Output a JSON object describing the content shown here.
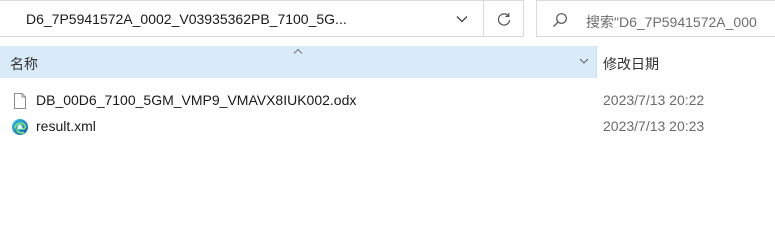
{
  "address_bar": {
    "path": "D6_7P5941572A_0002_V03935362PB_7100_5G..."
  },
  "search": {
    "placeholder": "搜索\"D6_7P5941572A_000"
  },
  "columns": {
    "name": "名称",
    "date_modified": "修改日期"
  },
  "files": [
    {
      "name": "DB_00D6_7100_5GM_VMP9_VMAVX8IUK002.odx",
      "date": "2023/7/13 20:22",
      "icon": "generic-file-icon"
    },
    {
      "name": "result.xml",
      "date": "2023/7/13 20:23",
      "icon": "edge-xml-icon"
    }
  ],
  "colors": {
    "header_selected": "#d9ebf9",
    "border": "#d9d9d9",
    "date_text": "#6b6b6b"
  }
}
